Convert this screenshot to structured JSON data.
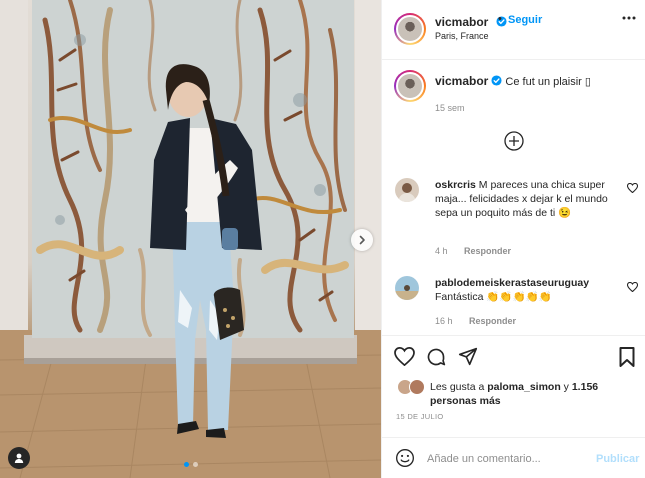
{
  "header": {
    "username": "vicmabor",
    "separator": "•",
    "follow_label": "Seguir",
    "location": "Paris, France"
  },
  "caption": {
    "username": "vicmabor",
    "text": "Ce fut un plaisir ▯",
    "time": "15 sem"
  },
  "comments": [
    {
      "username": "oskrcris",
      "text": "M pareces una chica super maja... felicidades x dejar k el mundo sepa un poquito más de ti 😉",
      "time": "4 h",
      "reply_label": "Responder"
    },
    {
      "username": "pablodemeiskerastaseuruguay",
      "text": "Fantástica 👏👏👏👏👏",
      "time": "16 h",
      "reply_label": "Responder"
    }
  ],
  "likes": {
    "prefix": "Les gusta a ",
    "user": "paloma_simon",
    "middle": " y ",
    "count": "1.156 personas más"
  },
  "date": "15 DE JULIO",
  "comment_box": {
    "placeholder": "Añade un comentario...",
    "post_label": "Publicar"
  },
  "carousel": {
    "total": 2,
    "active": 0
  },
  "colors": {
    "accent": "#0095f6",
    "post_disabled": "#b2dffc",
    "muted": "#8e8e8e",
    "text": "#262626"
  },
  "icons": {
    "verified": "verified-badge-icon",
    "more": "more-options-icon",
    "load_more": "plus-circle-icon",
    "like": "heart-icon",
    "comment": "comment-bubble-icon",
    "share": "paper-plane-icon",
    "save": "bookmark-icon",
    "emoji": "smiley-icon",
    "carousel_next": "chevron-right-icon",
    "tags": "user-tag-icon"
  }
}
